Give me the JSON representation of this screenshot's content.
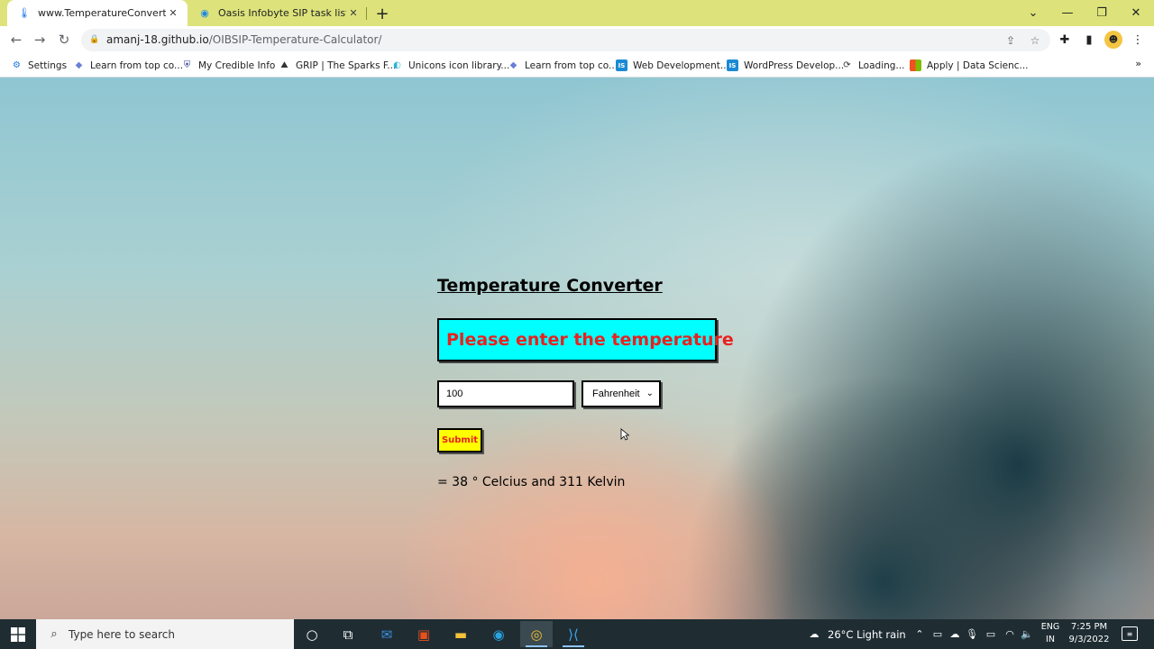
{
  "browser": {
    "tabs": [
      {
        "title": "www.TemperatureConverter.com",
        "active": true
      },
      {
        "title": "Oasis Infobyte SIP task list",
        "active": false
      }
    ],
    "url_host": "amanj-18.github.io",
    "url_path": "/OIBSIP-Temperature-Calculator/",
    "bookmarks": [
      "Settings",
      "Learn from top co...",
      "My Credible Info",
      "GRIP | The Sparks F...",
      "Unicons icon library...",
      "Learn from top co...",
      "Web Development...",
      "WordPress Develop...",
      "Loading...",
      "Apply | Data Scienc..."
    ],
    "bookmarks_more": "»"
  },
  "app": {
    "title": "Temperature Converter",
    "prompt": "Please enter the temperature",
    "input_value": "100",
    "unit_selected": "Fahrenheit",
    "submit_label": "Submit",
    "result": "= 38 ° Celcius and 311 Kelvin"
  },
  "taskbar": {
    "search_placeholder": "Type here to search",
    "weather": "26°C  Light rain",
    "lang_line1": "ENG",
    "lang_line2": "IN",
    "time": "7:25 PM",
    "date": "9/3/2022"
  },
  "colors": {
    "tabstrip": "#dde37a",
    "prompt_bg": "#00ffff",
    "prompt_text": "#e8211f",
    "submit_bg": "#ffff00",
    "taskbar": "#1f2d33"
  }
}
